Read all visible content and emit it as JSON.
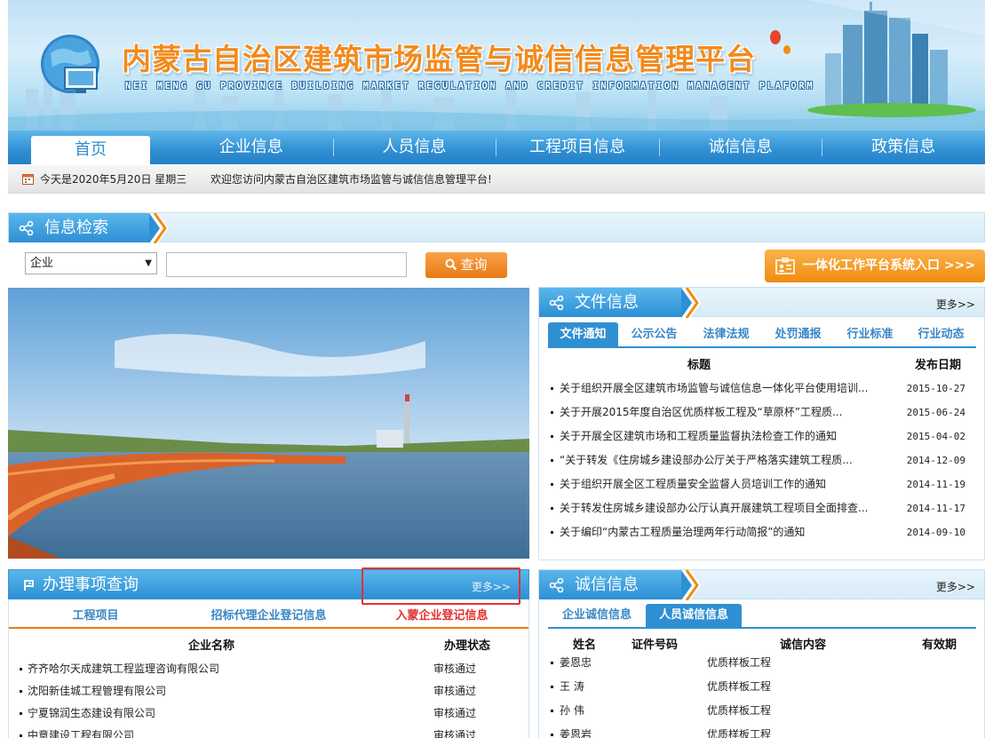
{
  "header": {
    "title": "内蒙古自治区建筑市场监管与诚信信息管理平台",
    "subtitle": "NEI MENG GU PROVINCE BUILDING MARKET REGULATION AND CREDIT INFORMATION MANAGENT PLAFORM"
  },
  "nav": [
    "首页",
    "企业信息",
    "人员信息",
    "工程项目信息",
    "诚信信息",
    "政策信息"
  ],
  "infobar": {
    "date": "今天是2020年5月20日  星期三",
    "welcome": "欢迎您访问内蒙古自治区建筑市场监管与诚信信息管理平台!"
  },
  "search": {
    "section_title": "信息检索",
    "select_value": "企业",
    "query_button": "查询",
    "platform_button": "一体化工作平台系统入口  >>>"
  },
  "files": {
    "section_title": "文件信息",
    "more": "更多>>",
    "tabs": [
      "文件通知",
      "公示公告",
      "法律法规",
      "处罚通报",
      "行业标准",
      "行业动态"
    ],
    "col_title": "标题",
    "col_date": "发布日期",
    "rows": [
      {
        "title": "关于组织开展全区建筑市场监管与诚信信息一体化平台使用培训...",
        "date": "2015-10-27"
      },
      {
        "title": "关于开展2015年度自治区优质样板工程及“草原杯”工程质...",
        "date": "2015-06-24"
      },
      {
        "title": "关于开展全区建筑市场和工程质量监督执法检查工作的通知",
        "date": "2015-04-02"
      },
      {
        "title": "“关于转发《住房城乡建设部办公厅关于严格落实建筑工程质...",
        "date": "2014-12-09"
      },
      {
        "title": "关于组织开展全区工程质量安全监督人员培训工作的通知",
        "date": "2014-11-19"
      },
      {
        "title": "关于转发住房城乡建设部办公厅认真开展建筑工程项目全面排查...",
        "date": "2014-11-17"
      },
      {
        "title": "关于编印“内蒙古工程质量治理两年行动简报”的通知",
        "date": "2014-09-10"
      }
    ]
  },
  "affairs": {
    "section_title": "办理事项查询",
    "more": "更多>>",
    "tabs": [
      "工程项目",
      "招标代理企业登记信息",
      "入蒙企业登记信息"
    ],
    "col_name": "企业名称",
    "col_status": "办理状态",
    "rows": [
      {
        "name": "齐齐哈尔天成建筑工程监理咨询有限公司",
        "status": "审核通过"
      },
      {
        "name": "沈阳新佳城工程管理有限公司",
        "status": "审核通过"
      },
      {
        "name": "宁夏锦润生态建设有限公司",
        "status": "审核通过"
      },
      {
        "name": "中意建设工程有限公司",
        "status": "审核通过"
      }
    ]
  },
  "credit": {
    "section_title": "诚信信息",
    "more": "更多>>",
    "tabs": [
      "企业诚信信息",
      "人员诚信信息"
    ],
    "col_name": "姓名",
    "col_cert": "证件号码",
    "col_content": "诚信内容",
    "col_valid": "有效期",
    "rows": [
      {
        "name": "姜恩忠",
        "content": "优质样板工程"
      },
      {
        "name": "王  涛",
        "content": "优质样板工程"
      },
      {
        "name": "孙  伟",
        "content": "优质样板工程"
      },
      {
        "name": "姜恩岩",
        "content": "优质样板工程"
      }
    ]
  },
  "colors": {
    "primary_blue": "#2f8fd3",
    "orange": "#f08c10",
    "active_tab_red": "#e53030"
  }
}
